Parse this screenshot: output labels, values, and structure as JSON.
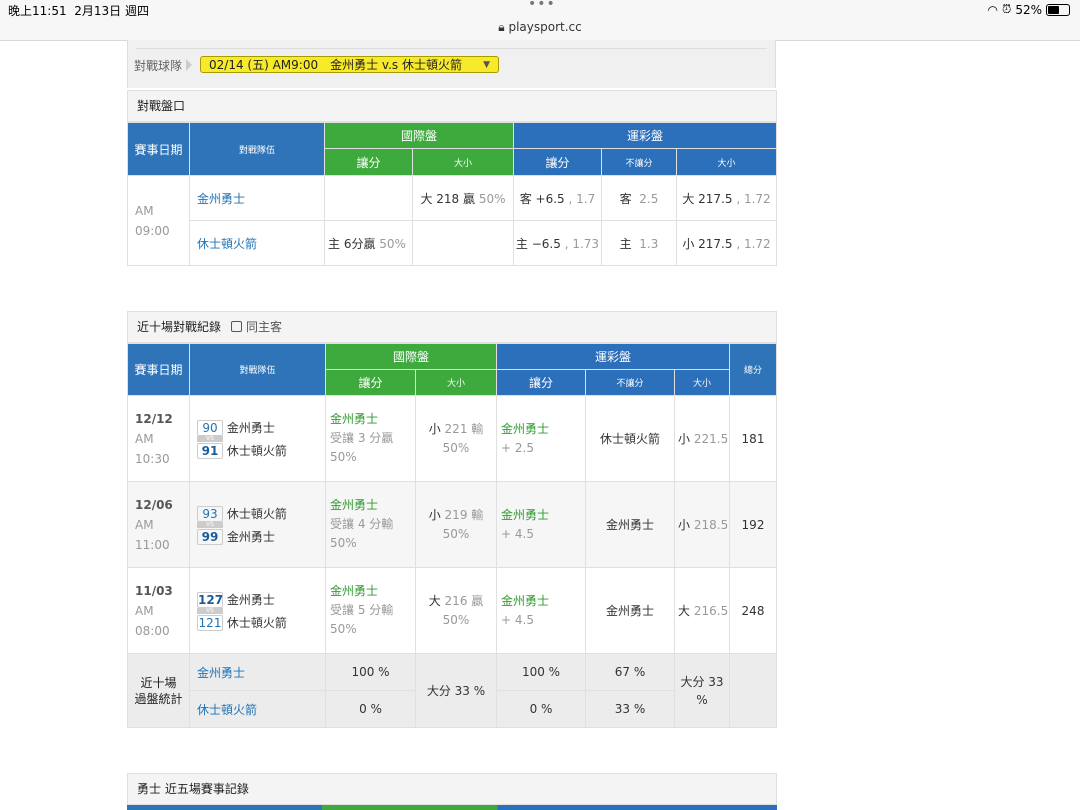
{
  "status_bar": {
    "time": "晚上11:51",
    "date": "2月13日 週四",
    "url": "playsport.cc",
    "battery": "52%",
    "dots": "•••"
  },
  "picker": {
    "label": "對戰球隊",
    "selected": "02/14 (五) AM9:00　金州勇士 v.s 休士頓火箭"
  },
  "odds_section": {
    "title": "對戰盤口",
    "headers": {
      "date": "賽事日期",
      "teams": "對戰隊伍",
      "intl": "國際盤",
      "lottery": "運彩盤",
      "spread": "讓分",
      "total": "大小",
      "no_spread": "不讓分"
    },
    "time_line1": "AM",
    "time_line2": "09:00",
    "rows": [
      {
        "team": "金州勇士",
        "intl_spread": "",
        "intl_total_main": "大 218 贏",
        "intl_total_pct": "50%",
        "lot_spread_main": "客 +6.5",
        "lot_spread_odds": ", 1.7",
        "lot_ml_main": "客",
        "lot_ml_odds": "2.5",
        "lot_total_main": "大 217.5",
        "lot_total_odds": ", 1.72"
      },
      {
        "team": "休士頓火箭",
        "intl_spread_main": "主 6分贏",
        "intl_spread_pct": "50%",
        "intl_total_main": "",
        "intl_total_pct": "",
        "lot_spread_main": "主 −6.5",
        "lot_spread_odds": ", 1.73",
        "lot_ml_main": "主",
        "lot_ml_odds": "1.3",
        "lot_total_main": "小 217.5",
        "lot_total_odds": ", 1.72"
      }
    ]
  },
  "h2h_section": {
    "title": "近十場對戰紀錄",
    "checkbox_label": "同主客",
    "headers": {
      "date": "賽事日期",
      "teams": "對戰隊伍",
      "intl": "國際盤",
      "lottery": "運彩盤",
      "spread": "讓分",
      "total": "大小",
      "no_spread": "不讓分",
      "sum": "總分"
    },
    "vs": "VS",
    "games": [
      {
        "date": "12/12",
        "ampm": "AM",
        "time": "10:30",
        "s1": "90",
        "t1": "金州勇士",
        "s2": "91",
        "t2": "休士頓火箭",
        "spread_team": "金州勇士",
        "spread_desc": "受讓 3 分贏",
        "spread_pct": "50%",
        "total_desc": "小",
        "total_val": "221",
        "total_res": "輸",
        "total_pct": "50%",
        "lot_team": "金州勇士",
        "lot_val": "+ 2.5",
        "ml_winner": "休士頓火箭",
        "lot_total": "小",
        "lot_total_val": "221.5",
        "sum": "181"
      },
      {
        "date": "12/06",
        "ampm": "AM",
        "time": "11:00",
        "s1": "93",
        "t1": "休士頓火箭",
        "s2": "99",
        "t2": "金州勇士",
        "spread_team": "金州勇士",
        "spread_desc": "受讓 4 分輸",
        "spread_pct": "50%",
        "total_desc": "小",
        "total_val": "219",
        "total_res": "輸",
        "total_pct": "50%",
        "lot_team": "金州勇士",
        "lot_val": "+ 4.5",
        "ml_winner": "金州勇士",
        "lot_total": "小",
        "lot_total_val": "218.5",
        "sum": "192"
      },
      {
        "date": "11/03",
        "ampm": "AM",
        "time": "08:00",
        "s1": "127",
        "t1": "金州勇士",
        "s2": "121",
        "t2": "休士頓火箭",
        "spread_team": "金州勇士",
        "spread_desc": "受讓 5 分輸",
        "spread_pct": "50%",
        "total_desc": "大",
        "total_val": "216",
        "total_res": "贏",
        "total_pct": "50%",
        "lot_team": "金州勇士",
        "lot_val": "+ 4.5",
        "ml_winner": "金州勇士",
        "lot_total": "大",
        "lot_total_val": "216.5",
        "sum": "248"
      }
    ],
    "stats": {
      "label1": "近十場",
      "label2": "過盤統計",
      "team1": "金州勇士",
      "team2": "休士頓火箭",
      "intl_spread1": "100 %",
      "intl_spread2": "0 %",
      "intl_total": "大分 33 %",
      "lot_spread1": "100 %",
      "lot_spread2": "0 %",
      "lot_ml1": "67 %",
      "lot_ml2": "33 %",
      "lot_total": "大分 33 %"
    }
  },
  "recent_section": {
    "title": "勇士 近五場賽事記錄"
  }
}
